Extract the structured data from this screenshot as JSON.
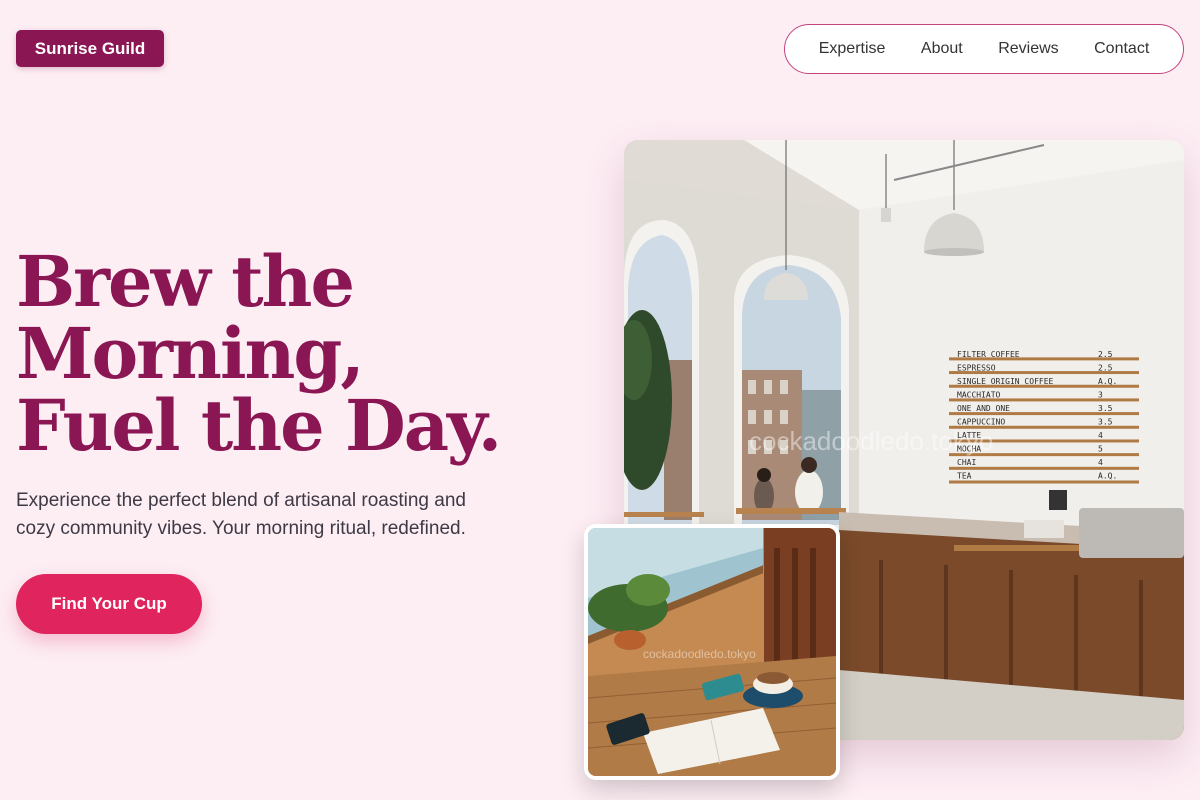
{
  "brand": {
    "name": "Sunrise Guild"
  },
  "nav": {
    "items": [
      {
        "label": "Expertise"
      },
      {
        "label": "About"
      },
      {
        "label": "Reviews"
      },
      {
        "label": "Contact"
      }
    ]
  },
  "hero": {
    "headline_lines": [
      "Brew the",
      "Morning,",
      "Fuel the Day."
    ],
    "subtext_line1": "Experience the perfect blend of artisanal roasting and",
    "subtext_line2": "cozy community vibes. Your morning ritual, redefined.",
    "cta_label": "Find Your Cup"
  },
  "photos": {
    "main": {
      "watermark": "cockadoodledo.tokyo",
      "menu_board": [
        {
          "item": "FILTER COFFEE",
          "price": "2.5"
        },
        {
          "item": "ESPRESSO",
          "price": "2.5"
        },
        {
          "item": "SINGLE ORIGIN COFFEE",
          "price": "A.Q."
        },
        {
          "item": "MACCHIATO",
          "price": "3"
        },
        {
          "item": "ONE AND ONE",
          "price": "3.5"
        },
        {
          "item": "CAPPUCCINO",
          "price": "3.5"
        },
        {
          "item": "LATTE",
          "price": "4"
        },
        {
          "item": "MOCHA",
          "price": "5"
        },
        {
          "item": "CHAI",
          "price": "4"
        },
        {
          "item": "TEA",
          "price": "A.Q."
        }
      ]
    },
    "small": {
      "watermark": "cockadoodledo.tokyo"
    }
  },
  "colors": {
    "background": "#fdeef4",
    "brand": "#8a1654",
    "accent": "#e0245e",
    "nav_border": "#c2457f"
  }
}
